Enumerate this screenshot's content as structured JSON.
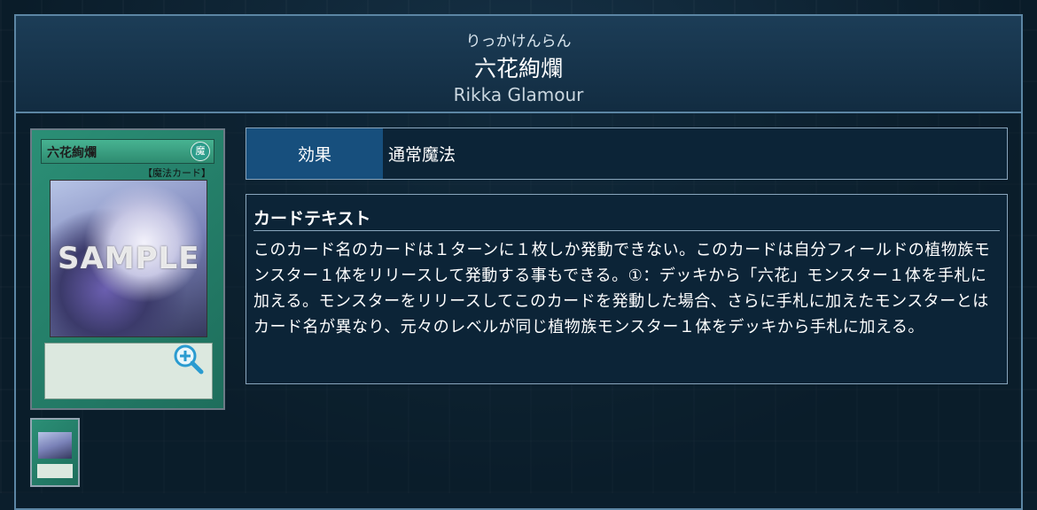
{
  "card": {
    "ruby": "りっかけんらん",
    "name_jp": "六花絢爛",
    "name_en": "Rikka Glamour",
    "image": {
      "title": "六花絢爛",
      "attribute_symbol": "魔",
      "type_text": "【魔法カード】",
      "watermark": "SAMPLE"
    }
  },
  "info": {
    "type_label": "効果",
    "type_value": "通常魔法"
  },
  "card_text": {
    "heading": "カードテキスト",
    "body": "このカード名のカードは１ターンに１枚しか発動できない。このカードは自分フィールドの植物族モンスター１体をリリースして発動する事もできる。①：デッキから「六花」モンスター１体を手札に加える。モンスターをリリースしてこのカードを発動した場合、さらに手札に加えたモンスターとはカード名が異なり、元々のレベルが同じ植物族モンスター１体をデッキから手札に加える。"
  },
  "colors": {
    "background": "#0b1e2c",
    "frame_border": "#5c86a4",
    "label_bg": "#174f7d"
  },
  "icons": {
    "zoom": "zoom-in-icon"
  }
}
